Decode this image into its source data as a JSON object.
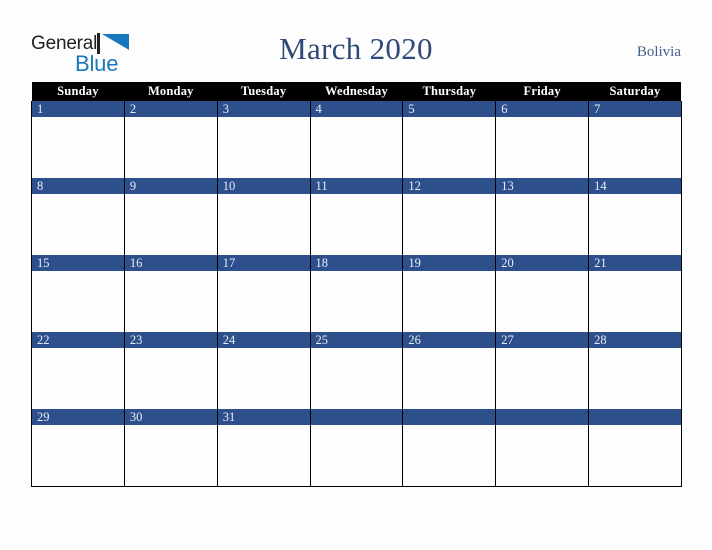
{
  "logo": {
    "word_1": "General",
    "word_2": "Blue",
    "triangle_color": "#1878be",
    "word_1_color": "#231f20",
    "word_2_color": "#1878be"
  },
  "header": {
    "title": "March 2020",
    "country": "Bolivia",
    "title_color": "#2f4a77",
    "country_color": "#456191"
  },
  "calendar": {
    "weekday_headers": [
      "Sunday",
      "Monday",
      "Tuesday",
      "Wednesday",
      "Thursday",
      "Friday",
      "Saturday"
    ],
    "header_background": "#000000",
    "header_text_color": "#ffffff",
    "date_bar_color": "#2d4f8c",
    "date_text_color": "#e9edf5",
    "cell_background": "#fdfdfd",
    "grid_line_color": "#000000",
    "weeks": [
      {
        "days": [
          {
            "number": "1"
          },
          {
            "number": "2"
          },
          {
            "number": "3"
          },
          {
            "number": "4"
          },
          {
            "number": "5"
          },
          {
            "number": "6"
          },
          {
            "number": "7"
          }
        ]
      },
      {
        "days": [
          {
            "number": "8"
          },
          {
            "number": "9"
          },
          {
            "number": "10"
          },
          {
            "number": "11"
          },
          {
            "number": "12"
          },
          {
            "number": "13"
          },
          {
            "number": "14"
          }
        ]
      },
      {
        "days": [
          {
            "number": "15"
          },
          {
            "number": "16"
          },
          {
            "number": "17"
          },
          {
            "number": "18"
          },
          {
            "number": "19"
          },
          {
            "number": "20"
          },
          {
            "number": "21"
          }
        ]
      },
      {
        "days": [
          {
            "number": "22"
          },
          {
            "number": "23"
          },
          {
            "number": "24"
          },
          {
            "number": "25"
          },
          {
            "number": "26"
          },
          {
            "number": "27"
          },
          {
            "number": "28"
          }
        ]
      },
      {
        "days": [
          {
            "number": "29"
          },
          {
            "number": "30"
          },
          {
            "number": "31"
          },
          {
            "number": ""
          },
          {
            "number": ""
          },
          {
            "number": ""
          },
          {
            "number": ""
          }
        ]
      }
    ]
  },
  "page": {
    "background": "#fdfdfd"
  }
}
